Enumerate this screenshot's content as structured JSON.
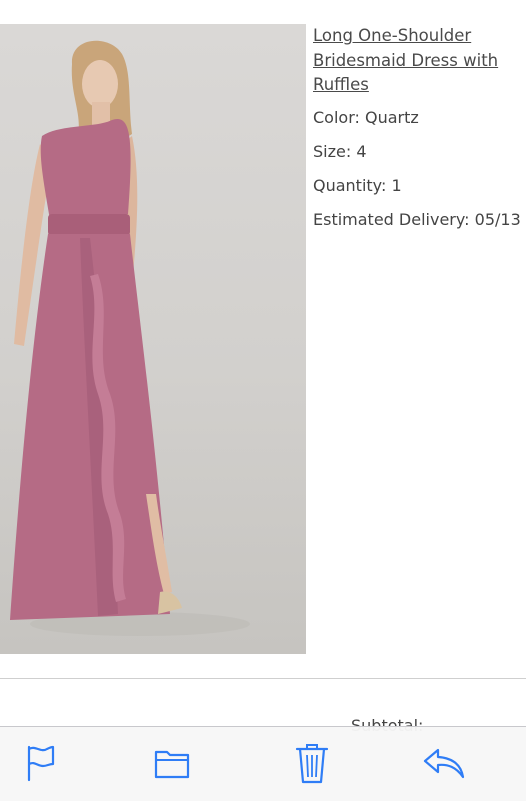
{
  "product": {
    "title": "Long One-Shoulder Bridesmaid Dress with Ruffles",
    "color": "Color: Quartz",
    "size": "Size: 4",
    "quantity": "Quantity: 1",
    "delivery": "Estimated Delivery: 05/13"
  },
  "order": {
    "subtotal_label": "Subtotal:"
  },
  "toolbar": {
    "icons": [
      "flag-icon",
      "folder-icon",
      "trash-icon",
      "reply-icon"
    ],
    "tint": "#2f7df6"
  },
  "colors": {
    "dress": "#b56b85",
    "backdrop": "#d6d4d2"
  }
}
